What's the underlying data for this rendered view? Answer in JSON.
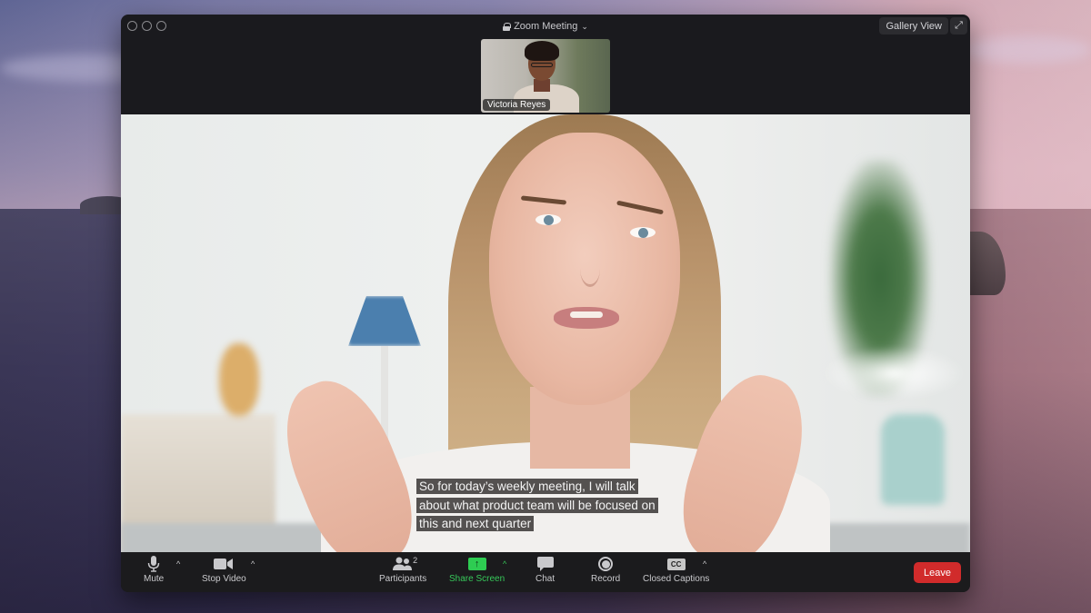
{
  "window": {
    "title": "Zoom Meeting",
    "gallery_view_label": "Gallery View"
  },
  "thumbnail": {
    "participant_name": "Victoria Reyes"
  },
  "caption": {
    "lines": [
      "So for today’s weekly meeting, I will talk",
      "about what product team will be focused on",
      "this and next quarter"
    ]
  },
  "toolbar": {
    "mute_label": "Mute",
    "stop_video_label": "Stop Video",
    "participants_label": "Participants",
    "participants_count": "2",
    "share_screen_label": "Share Screen",
    "chat_label": "Chat",
    "record_label": "Record",
    "closed_captions_label": "Closed Captions",
    "cc_icon_text": "CC",
    "leave_label": "Leave",
    "caret": "^"
  },
  "colors": {
    "leave": "#d12b2b",
    "share_screen": "#2ecc52"
  }
}
